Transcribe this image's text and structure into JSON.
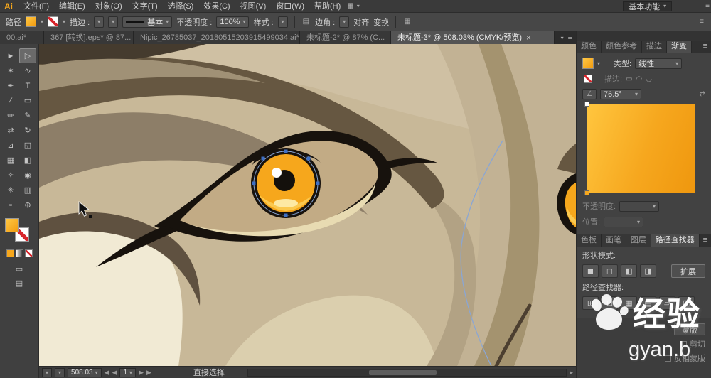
{
  "colors": {
    "accent": "#f6a71c",
    "canvas_base": "#c8b898",
    "selection_blue": "#88a6d6"
  },
  "icons": {
    "caret": "▾",
    "menu": "≡",
    "close": "×",
    "arrow_left": "◀",
    "arrow_right": "▶",
    "scroll_left": "◂",
    "scroll_right": "▸",
    "angle": "∠",
    "swap": "⇄",
    "grid": "▦",
    "columns": "▤",
    "stroke_cap": "▭",
    "stroke_join": "◠",
    "stroke_align": "◡"
  },
  "menubar": {
    "logo": "Ai",
    "items": [
      "文件(F)",
      "编辑(E)",
      "对象(O)",
      "文字(T)",
      "选择(S)",
      "效果(C)",
      "视图(V)",
      "窗口(W)",
      "帮助(H)"
    ],
    "workspace": "基本功能"
  },
  "control_bar": {
    "target_label": "路径",
    "stroke_link": "描边 :",
    "brush_value": "基本",
    "opacity_link": "不透明度 :",
    "opacity_value": "100%",
    "style_label": "样式 :",
    "corner_label": "边角 :",
    "align_button": "对齐",
    "transform_button": "变换"
  },
  "doc_tabs": [
    "00.ai*",
    "367 [转换].eps* @ 87...",
    "Nipic_26785037_20180515203915499034.ai*",
    "未标题-2* @ 87% (C...",
    "未标题-3* @ 508.03% (CMYK/预览)"
  ],
  "toolbar": {
    "tools": [
      {
        "name": "selection-tool",
        "glyph": "►"
      },
      {
        "name": "direct-selection-tool",
        "glyph": "▷"
      },
      {
        "name": "magic-wand-tool",
        "glyph": "✶"
      },
      {
        "name": "lasso-tool",
        "glyph": "∿"
      },
      {
        "name": "pen-tool",
        "glyph": "✒"
      },
      {
        "name": "type-tool",
        "glyph": "T"
      },
      {
        "name": "line-segment-tool",
        "glyph": "∕"
      },
      {
        "name": "rectangle-tool",
        "glyph": "▭"
      },
      {
        "name": "paintbrush-tool",
        "glyph": "✏"
      },
      {
        "name": "pencil-tool",
        "glyph": "✎"
      },
      {
        "name": "width-tool",
        "glyph": "⇄"
      },
      {
        "name": "rotate-tool",
        "glyph": "↻"
      },
      {
        "name": "scale-tool",
        "glyph": "⊿"
      },
      {
        "name": "shape-builder-tool",
        "glyph": "◱"
      },
      {
        "name": "mesh-tool",
        "glyph": "▦"
      },
      {
        "name": "gradient-tool",
        "glyph": "◧"
      },
      {
        "name": "eyedropper-tool",
        "glyph": "✧"
      },
      {
        "name": "blend-tool",
        "glyph": "◉"
      },
      {
        "name": "symbol-sprayer-tool",
        "glyph": "✳"
      },
      {
        "name": "column-graph-tool",
        "glyph": "▥"
      },
      {
        "name": "artboard-tool",
        "glyph": "▫"
      },
      {
        "name": "zoom-tool",
        "glyph": "⊕"
      }
    ]
  },
  "right_panel": {
    "top_tabs": [
      "颜色",
      "颜色参考",
      "描边",
      "渐变"
    ],
    "gradient": {
      "type_label": "类型:",
      "type_value": "线性",
      "stroke_label": "描边:",
      "angle_value": "76.5°",
      "opacity_label": "不透明度:",
      "position_label": "位置:"
    },
    "mid_tabs": [
      "色板",
      "画笔",
      "图层",
      "路径查找器"
    ],
    "pathfinder": {
      "shape_modes_label": "形状模式:",
      "shape_mode_glyphs": [
        "◼",
        "◻",
        "◧",
        "◨"
      ],
      "expand_button": "扩展",
      "pathfinder_label": "路径查找器:",
      "pathfinder_glyphs": [
        "⊞",
        "⊟",
        "▦",
        "▤",
        "▱",
        "◫"
      ]
    },
    "transparency": {
      "mask_button": "蒙版",
      "clip_label": "剪切",
      "invert_label": "反相蒙版"
    }
  },
  "status_bar": {
    "zoom": "508.03",
    "page": "1",
    "tool_name": "直接选择"
  },
  "watermark": {
    "text": "经验",
    "subtext": "gyan.b"
  }
}
